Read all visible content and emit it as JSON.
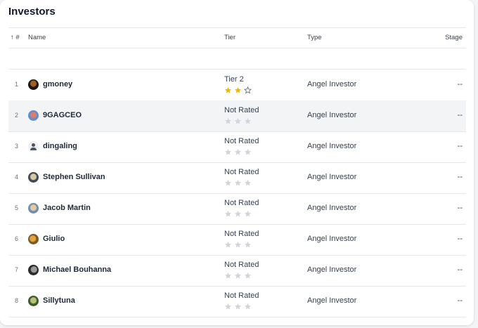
{
  "title": "Investors",
  "columns": {
    "sort": "↑ #",
    "name": "Name",
    "tier": "Tier",
    "type": "Type",
    "stage": "Stage"
  },
  "colors": {
    "star_filled": "#f2b705",
    "star_empty": "#d1d5db",
    "highlight_row": "#f3f4f6"
  },
  "rows": [
    {
      "num": "1",
      "name": "gmoney",
      "tier": "Tier 2",
      "rating": 2,
      "type": "Angel Investor",
      "stage": "--",
      "avatar": "photo-dark"
    },
    {
      "num": "2",
      "name": "9GAGCEO",
      "tier": "Not Rated",
      "rating": 0,
      "type": "Angel Investor",
      "stage": "--",
      "avatar": "photo-blue"
    },
    {
      "num": "3",
      "name": "dingaling",
      "tier": "Not Rated",
      "rating": 0,
      "type": "Angel Investor",
      "stage": "--",
      "avatar": "generic-user-icon"
    },
    {
      "num": "4",
      "name": "Stephen Sullivan",
      "tier": "Not Rated",
      "rating": 0,
      "type": "Angel Investor",
      "stage": "--",
      "avatar": "photo-cartoon"
    },
    {
      "num": "5",
      "name": "Jacob Martin",
      "tier": "Not Rated",
      "rating": 0,
      "type": "Angel Investor",
      "stage": "--",
      "avatar": "photo-cartoon-blue"
    },
    {
      "num": "6",
      "name": "Giulio",
      "tier": "Not Rated",
      "rating": 0,
      "type": "Angel Investor",
      "stage": "--",
      "avatar": "photo-orange"
    },
    {
      "num": "7",
      "name": "Michael Bouhanna",
      "tier": "Not Rated",
      "rating": 0,
      "type": "Angel Investor",
      "stage": "--",
      "avatar": "photo-bw"
    },
    {
      "num": "8",
      "name": "Sillytuna",
      "tier": "Not Rated",
      "rating": 0,
      "type": "Angel Investor",
      "stage": "--",
      "avatar": "photo-green"
    }
  ]
}
